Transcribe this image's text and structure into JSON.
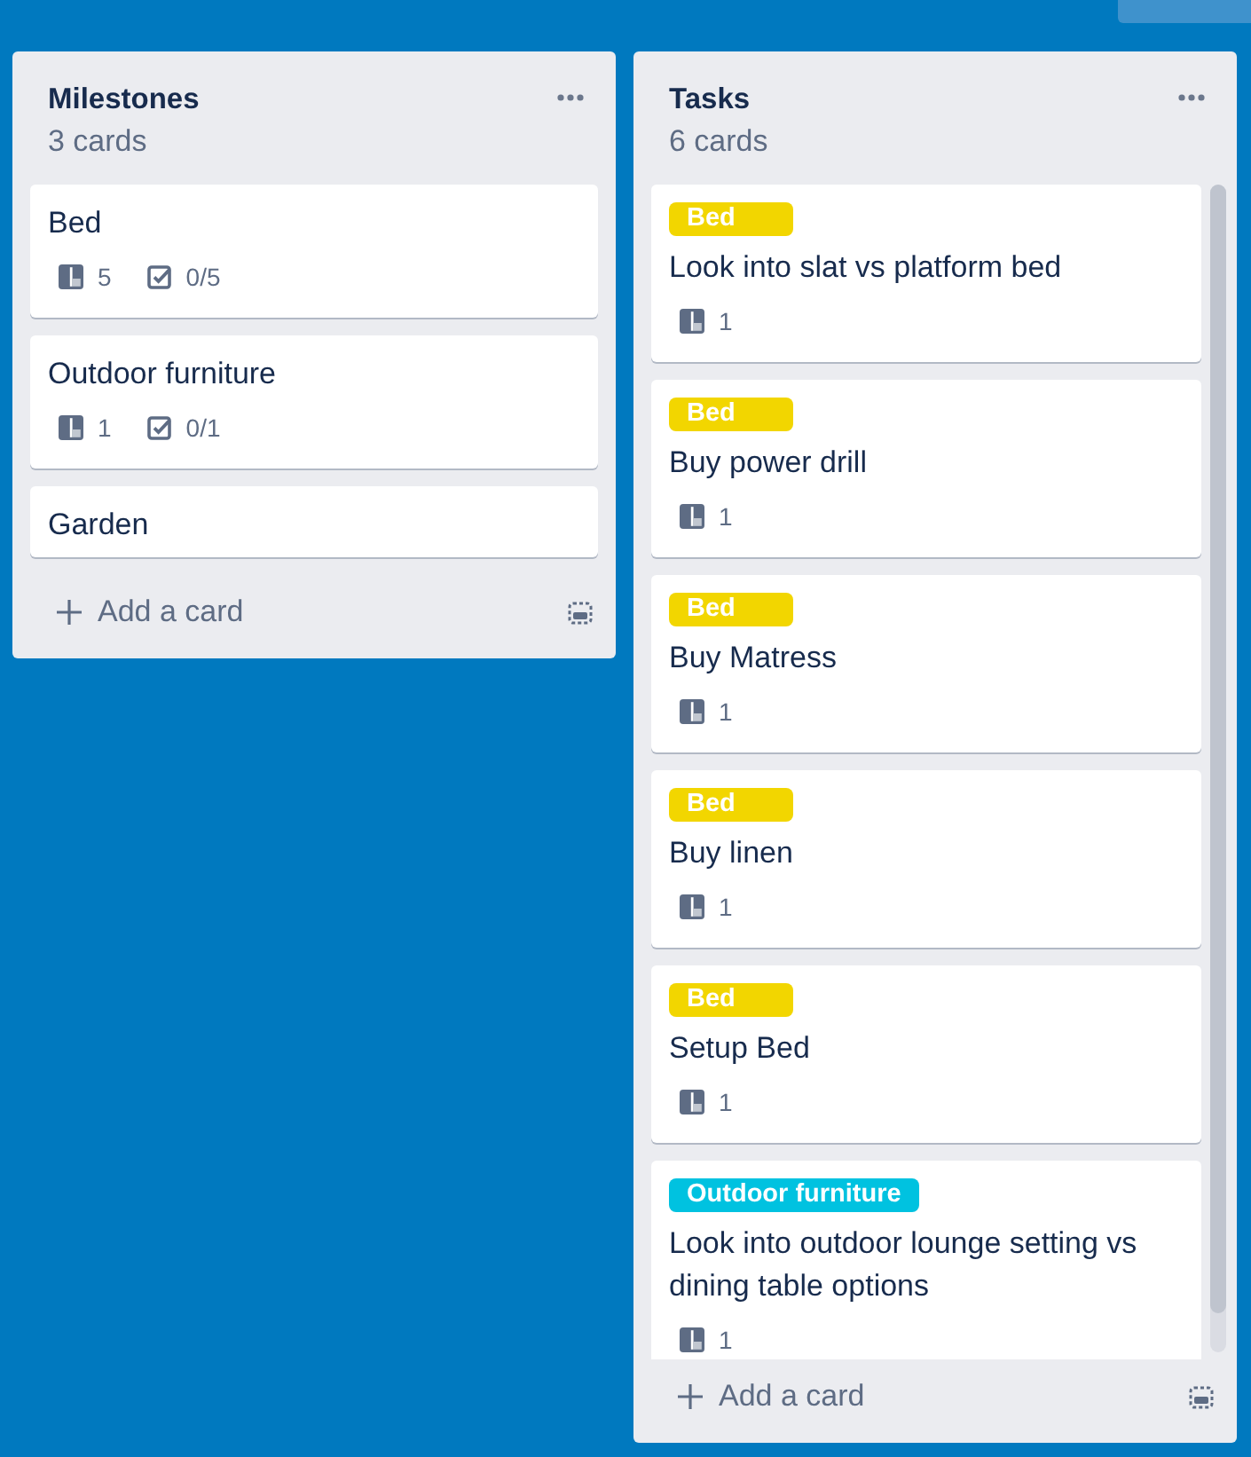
{
  "lists": [
    {
      "title": "Milestones",
      "count": "3 cards",
      "scrollable": false,
      "cards": [
        {
          "title": "Bed",
          "badges": [
            {
              "kind": "cards",
              "text": "5"
            },
            {
              "kind": "checklist",
              "text": "0/5"
            }
          ]
        },
        {
          "title": "Outdoor furniture",
          "badges": [
            {
              "kind": "cards",
              "text": "1"
            },
            {
              "kind": "checklist",
              "text": "0/1"
            }
          ]
        },
        {
          "title": "Garden"
        }
      ],
      "add_card": "Add a card"
    },
    {
      "title": "Tasks",
      "count": "6 cards",
      "scrollable": true,
      "cards": [
        {
          "labels": [
            {
              "text": "Bed",
              "color": "#f2d600"
            }
          ],
          "title": "Look into slat vs platform bed",
          "badges": [
            {
              "kind": "cards",
              "text": "1"
            }
          ]
        },
        {
          "labels": [
            {
              "text": "Bed",
              "color": "#f2d600"
            }
          ],
          "title": "Buy power drill",
          "badges": [
            {
              "kind": "cards",
              "text": "1"
            }
          ]
        },
        {
          "labels": [
            {
              "text": "Bed",
              "color": "#f2d600"
            }
          ],
          "title": "Buy Matress",
          "badges": [
            {
              "kind": "cards",
              "text": "1"
            }
          ]
        },
        {
          "labels": [
            {
              "text": "Bed",
              "color": "#f2d600"
            }
          ],
          "title": "Buy linen",
          "badges": [
            {
              "kind": "cards",
              "text": "1"
            }
          ]
        },
        {
          "labels": [
            {
              "text": "Bed",
              "color": "#f2d600"
            }
          ],
          "title": "Setup Bed",
          "badges": [
            {
              "kind": "cards",
              "text": "1"
            }
          ]
        },
        {
          "labels": [
            {
              "text": "Outdoor furniture",
              "color": "#00c2e0"
            }
          ],
          "title": "Look into outdoor lounge setting vs dining table options",
          "badges": [
            {
              "kind": "cards",
              "text": "1"
            }
          ]
        }
      ],
      "add_card": "Add a card"
    }
  ]
}
